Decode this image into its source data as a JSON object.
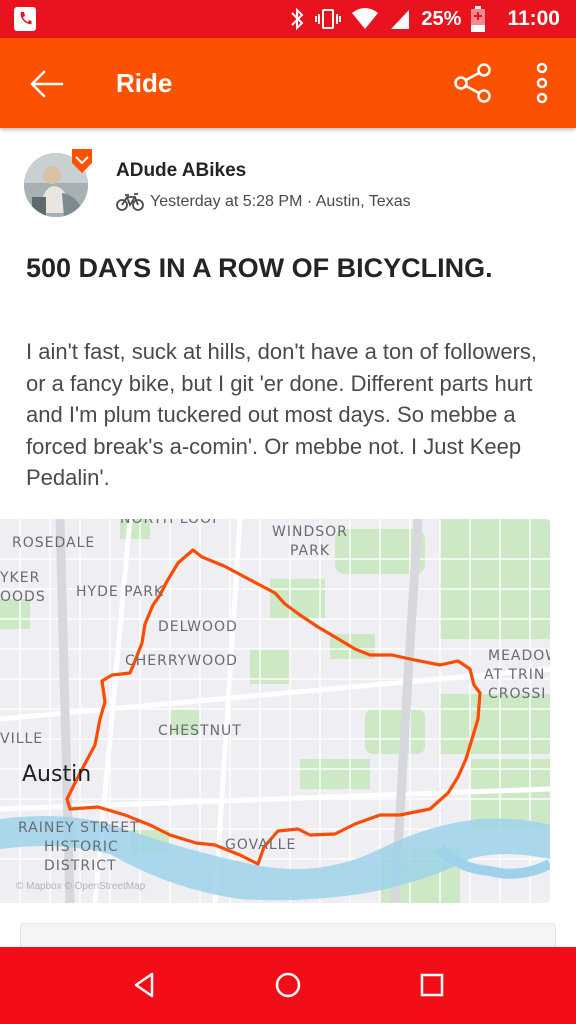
{
  "status_bar": {
    "battery": "25%",
    "time": "11:00",
    "icons": [
      "phone-icon",
      "bluetooth-icon",
      "vibrate-icon",
      "wifi-icon",
      "signal-icon",
      "battery-icon"
    ]
  },
  "app_bar": {
    "title": "Ride",
    "icons": [
      "back-arrow-icon",
      "share-icon",
      "more-vert-icon"
    ]
  },
  "activity": {
    "athlete_name": "ADude ABikes",
    "activity_icon": "bike-icon",
    "meta": "Yesterday at 5:28 PM · Austin, Texas",
    "title": "500 DAYS IN A ROW OF BICYCLING.",
    "description": "I ain't fast, suck at hills, don't have a ton of followers, or a fancy bike, but I git 'er done. Different parts hurt and I'm plum tuckered out most days. So mebbe a forced break's a-comin'. Or mebbe not. I Just Keep Pedalin'."
  },
  "map": {
    "route_color": "#fc4c02",
    "labels": {
      "north_loop": "NORTH LOOP",
      "rosedale": "ROSEDALE",
      "windsor_park_1": "WINDSOR",
      "windsor_park_2": "PARK",
      "kerby_1": "YKER",
      "kerby_2": "OODS",
      "hyde_park": "HYDE PARK",
      "delwood": "DELWOOD",
      "cherrywood": "CHERRYWOOD",
      "meadow_1": "MEADOW",
      "meadow_2": "AT TRIN",
      "meadow_3": "CROSSI",
      "chestnut": "CHESTNUT",
      "ville": "VILLE",
      "austin": "Austin",
      "rainey": "RAINEY STREET",
      "historic_1": "HISTORIC",
      "historic_2": "DISTRICT",
      "govalle": "GOVALLE",
      "attribution": "© Mapbox © OpenStreetMap"
    }
  },
  "colors": {
    "status_bar": "#e8131f",
    "app_bar": "#fc5200",
    "nav_bar": "#f20d18"
  },
  "nav_bar": {
    "icons": [
      "back-triangle-icon",
      "home-circle-icon",
      "recents-square-icon"
    ]
  }
}
